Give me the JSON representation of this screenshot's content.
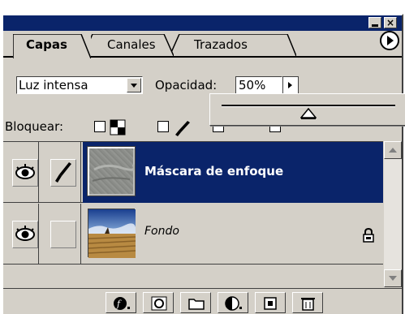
{
  "title_bar": {
    "close_label": "×"
  },
  "tabs": [
    {
      "label": "Capas",
      "active": true
    },
    {
      "label": "Canales",
      "active": false
    },
    {
      "label": "Trazados",
      "active": false
    }
  ],
  "blend_mode": {
    "value": "Luz intensa"
  },
  "opacity": {
    "label": "Opacidad:",
    "value": "50%",
    "slider_fraction": 0.5
  },
  "lock": {
    "label": "Bloquear:"
  },
  "layers": [
    {
      "name": "Máscara de enfoque",
      "visible": true,
      "brush": true,
      "selected": true
    },
    {
      "name": "Fondo",
      "visible": true,
      "brush": false,
      "locked": true,
      "selected": false
    }
  ],
  "colors": {
    "selection": "#0a246a",
    "panel": "#d4d0c8"
  },
  "icons": [
    "eye-icon",
    "brush-icon",
    "lock-icon",
    "layer-style-icon",
    "mask-icon",
    "folder-icon",
    "adjustment-icon",
    "new-layer-icon",
    "trash-icon",
    "panel-menu-icon"
  ]
}
